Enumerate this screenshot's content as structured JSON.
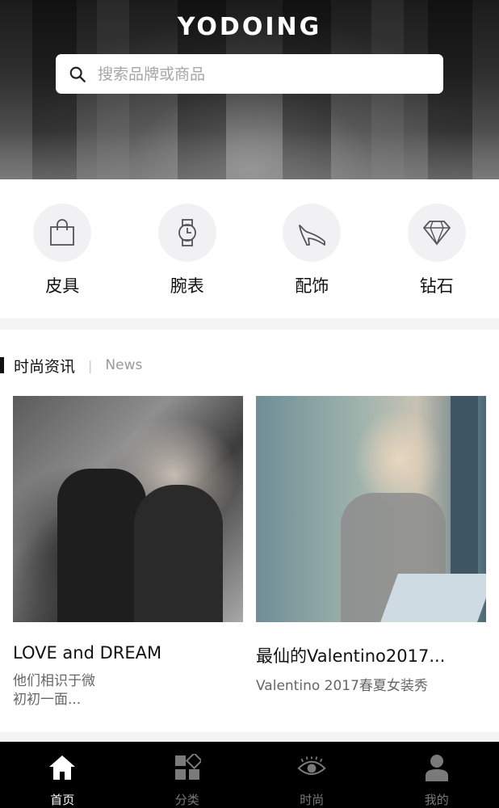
{
  "header": {
    "brand": "YODOING",
    "search_placeholder": "搜索品牌或商品"
  },
  "categories": [
    {
      "label": "皮具",
      "icon": "handbag-icon"
    },
    {
      "label": "腕表",
      "icon": "watch-icon"
    },
    {
      "label": "配饰",
      "icon": "high-heel-icon"
    },
    {
      "label": "钻石",
      "icon": "diamond-icon"
    }
  ],
  "news": {
    "title": "时尚资讯",
    "separator": "|",
    "subtitle": "News",
    "cards": [
      {
        "headline": "LOVE and DREAM",
        "desc_line1": "他们相识于微",
        "desc_line2": "初初一面..."
      },
      {
        "headline": "最仙的Valentino2017...",
        "desc_line1": "Valentino 2017春夏女装秀",
        "desc_line2": ""
      }
    ]
  },
  "tabbar": {
    "items": [
      {
        "label": "首页",
        "icon": "home-icon",
        "active": true
      },
      {
        "label": "分类",
        "icon": "category-icon",
        "active": false
      },
      {
        "label": "时尚",
        "icon": "eye-icon",
        "active": false
      },
      {
        "label": "我的",
        "icon": "user-icon",
        "active": false
      }
    ]
  },
  "colors": {
    "tabbar_bg": "#000000",
    "tab_active": "#ffffff",
    "tab_inactive": "#7a7a7a",
    "icon_circle_bg": "#f1f1f3"
  }
}
